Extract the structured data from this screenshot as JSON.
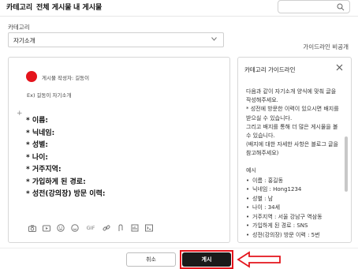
{
  "header": {
    "tabs": [
      "카테고리",
      "전체 게시물",
      "내 게시물"
    ],
    "search_icon": "search-icon"
  },
  "form": {
    "category_label": "카테고리",
    "category_value": "자기소개",
    "guideline_toggle": "가이드라인 비공개"
  },
  "editor": {
    "author_line": "게시물 작성자: 길동이",
    "example_line": "Ex) 길동이 자기소개",
    "fields": [
      "이름:",
      "닉네임:",
      "성별:",
      "나이:",
      "거주지역:",
      "가입하게 된 경로:",
      "성전(강의장) 방문 이력:"
    ],
    "toolbar_icons": [
      "camera-icon",
      "video-icon",
      "emoji-icon",
      "sticker-icon",
      "gif-label",
      "link-icon",
      "attach-icon",
      "file-icon",
      "code-icon"
    ],
    "gif_label": "GIF"
  },
  "guide": {
    "title": "카테고리 가이드라인",
    "intro": "다음과 같이 자기소개 양식에 맞춰 글을 작성해주세요.",
    "note1": "* 성전에 방문한 이력이 있으시면 배지를 받으실 수 있습니다.",
    "note2": "그리고 배지를 통해 더 많은 게시물을 볼 수 있습니다.",
    "note3": "(배지에 대한 자세한 사항은 블로그 글을 참고해주세요)",
    "example_title": "예시",
    "example_items": [
      "이름 : 홍길동",
      "닉네임 : Hong1234",
      "성별 : 남",
      "나이 : 34세",
      "거주지역 : 서울 강남구 역삼동",
      "가입하게 된 경로 : SNS",
      "성전(강의장) 방문 이력 : 5번"
    ]
  },
  "actions": {
    "cancel_label": "취소",
    "post_label": "게시"
  },
  "colors": {
    "accent_red": "#e4141c",
    "post_button": "#1a1a1a"
  }
}
